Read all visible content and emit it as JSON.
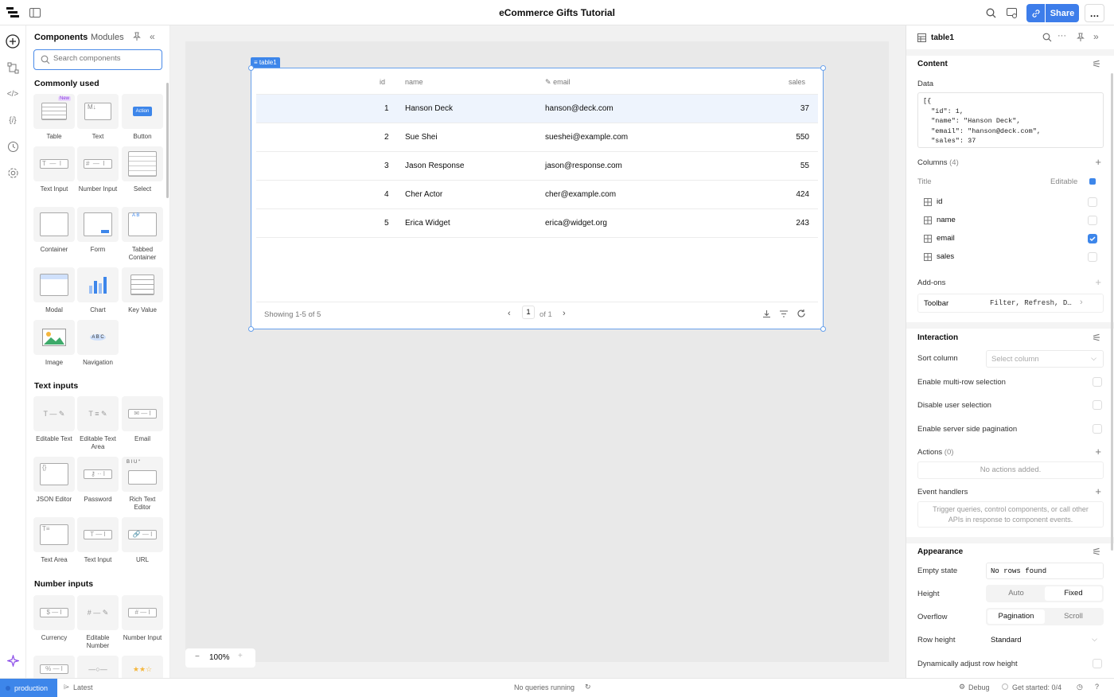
{
  "app": {
    "title": "eCommerce Gifts Tutorial",
    "share_label": "Share",
    "more_label": "…"
  },
  "panel": {
    "tabs": [
      "Components",
      "Modules"
    ],
    "search_placeholder": "Search components",
    "sections": {
      "common": "Commonly used",
      "text_inputs": "Text inputs",
      "number_inputs": "Number inputs"
    },
    "common_items": [
      "Table",
      "Text",
      "Button",
      "Text Input",
      "Number Input",
      "Select",
      "Container",
      "Form",
      "Tabbed Container",
      "Modal",
      "Chart",
      "Key Value",
      "Image",
      "Navigation"
    ],
    "text_items": [
      "Editable Text",
      "Editable Text Area",
      "Email",
      "JSON Editor",
      "Password",
      "Rich Text Editor",
      "Text Area",
      "Text Input",
      "URL"
    ],
    "number_items": [
      "Currency",
      "Editable Number",
      "Number Input"
    ],
    "badges": {
      "new": "New",
      "action": "Action",
      "text_md": "M↓",
      "tabs": "A  B",
      "nav": "A  B  C",
      "rte": "B  I  U  “"
    }
  },
  "table": {
    "badge": "≡ table1",
    "headers": {
      "id": "id",
      "name": "name",
      "email": "email",
      "sales": "sales"
    },
    "rows": [
      {
        "id": "1",
        "name": "Hanson Deck",
        "email": "hanson@deck.com",
        "sales": "37"
      },
      {
        "id": "2",
        "name": "Sue Shei",
        "email": "sueshei@example.com",
        "sales": "550"
      },
      {
        "id": "3",
        "name": "Jason Response",
        "email": "jason@response.com",
        "sales": "55"
      },
      {
        "id": "4",
        "name": "Cher Actor",
        "email": "cher@example.com",
        "sales": "424"
      },
      {
        "id": "5",
        "name": "Erica Widget",
        "email": "erica@widget.org",
        "sales": "243"
      }
    ],
    "footer": {
      "showing": "Showing 1-5 of 5",
      "page": "1",
      "of": "of 1"
    }
  },
  "zoom": {
    "value": "100%",
    "minus": "−",
    "plus": "+"
  },
  "inspector": {
    "component_name": "table1",
    "content": "Content",
    "data_label": "Data",
    "data_json": "[{\n  \"id\": 1,\n  \"name\": \"Hanson Deck\",\n  \"email\": \"hanson@deck.com\",\n  \"sales\": 37",
    "columns_label": "Columns",
    "columns_count": "(4)",
    "title_label": "Title",
    "editable_label": "Editable",
    "columns": [
      {
        "name": "id",
        "editable": false
      },
      {
        "name": "name",
        "editable": false
      },
      {
        "name": "email",
        "editable": true
      },
      {
        "name": "sales",
        "editable": false
      }
    ],
    "addons_label": "Add-ons",
    "toolbar_label": "Toolbar",
    "toolbar_value": "Filter, Refresh, D…",
    "interaction": "Interaction",
    "sort_column": "Sort column",
    "sort_placeholder": "Select column",
    "multi_row": "Enable multi-row selection",
    "disable_sel": "Disable user selection",
    "server_pag": "Enable server side pagination",
    "actions_label": "Actions",
    "actions_count": "(0)",
    "no_actions": "No actions added.",
    "event_handlers": "Event handlers",
    "event_hint": "Trigger queries, control components, or call other APIs in response to component events.",
    "appearance": "Appearance",
    "empty_state": "Empty state",
    "empty_value": "No rows found",
    "height": "Height",
    "height_opts": [
      "Auto",
      "Fixed"
    ],
    "overflow": "Overflow",
    "overflow_opts": [
      "Pagination",
      "Scroll"
    ],
    "row_height": "Row height",
    "row_height_value": "Standard",
    "dyn_row": "Dynamically adjust row height"
  },
  "status": {
    "env": "production",
    "branch": "Latest",
    "queries": "No queries running",
    "debug": "Debug",
    "get_started": "Get started: 0/4"
  },
  "colors": {
    "accent": "#3d86ea",
    "selection_row": "#eef4fd",
    "canvas": "#e9e9e9"
  }
}
